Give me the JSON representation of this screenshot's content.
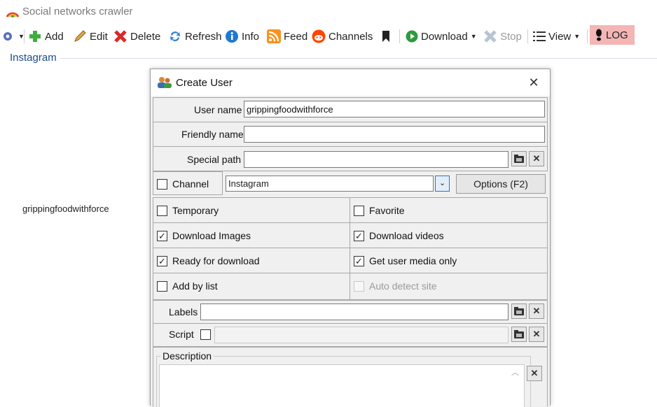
{
  "app": {
    "title": "Social networks crawler"
  },
  "toolbar": {
    "add": "Add",
    "edit": "Edit",
    "delete": "Delete",
    "refresh": "Refresh",
    "info": "Info",
    "feed": "Feed",
    "channels": "Channels",
    "download": "Download",
    "stop": "Stop",
    "view": "View",
    "log": "LOG"
  },
  "tab": {
    "label": "Instagram"
  },
  "list": {
    "items": [
      "grippingfoodwithforce"
    ]
  },
  "dialog": {
    "title": "Create User",
    "username_label": "User name",
    "username_value": "grippingfoodwithforce",
    "friendly_label": "Friendly name",
    "friendly_value": "",
    "special_path_label": "Special path",
    "special_path_value": "",
    "channel_label": "Channel",
    "channel_checked": false,
    "site_value": "Instagram",
    "options_button": "Options (F2)",
    "temporary": "Temporary",
    "favorite": "Favorite",
    "download_images": "Download Images",
    "download_videos": "Download videos",
    "ready_for_download": "Ready for download",
    "get_user_media_only": "Get user media only",
    "add_by_list": "Add by list",
    "auto_detect_site": "Auto detect site",
    "labels_label": "Labels",
    "labels_value": "",
    "script_label": "Script",
    "script_value": "",
    "description_label": "Description",
    "description_value": ""
  },
  "colors": {
    "log_bg": "#f4b5b5",
    "tab_text": "#1a4b8f"
  }
}
